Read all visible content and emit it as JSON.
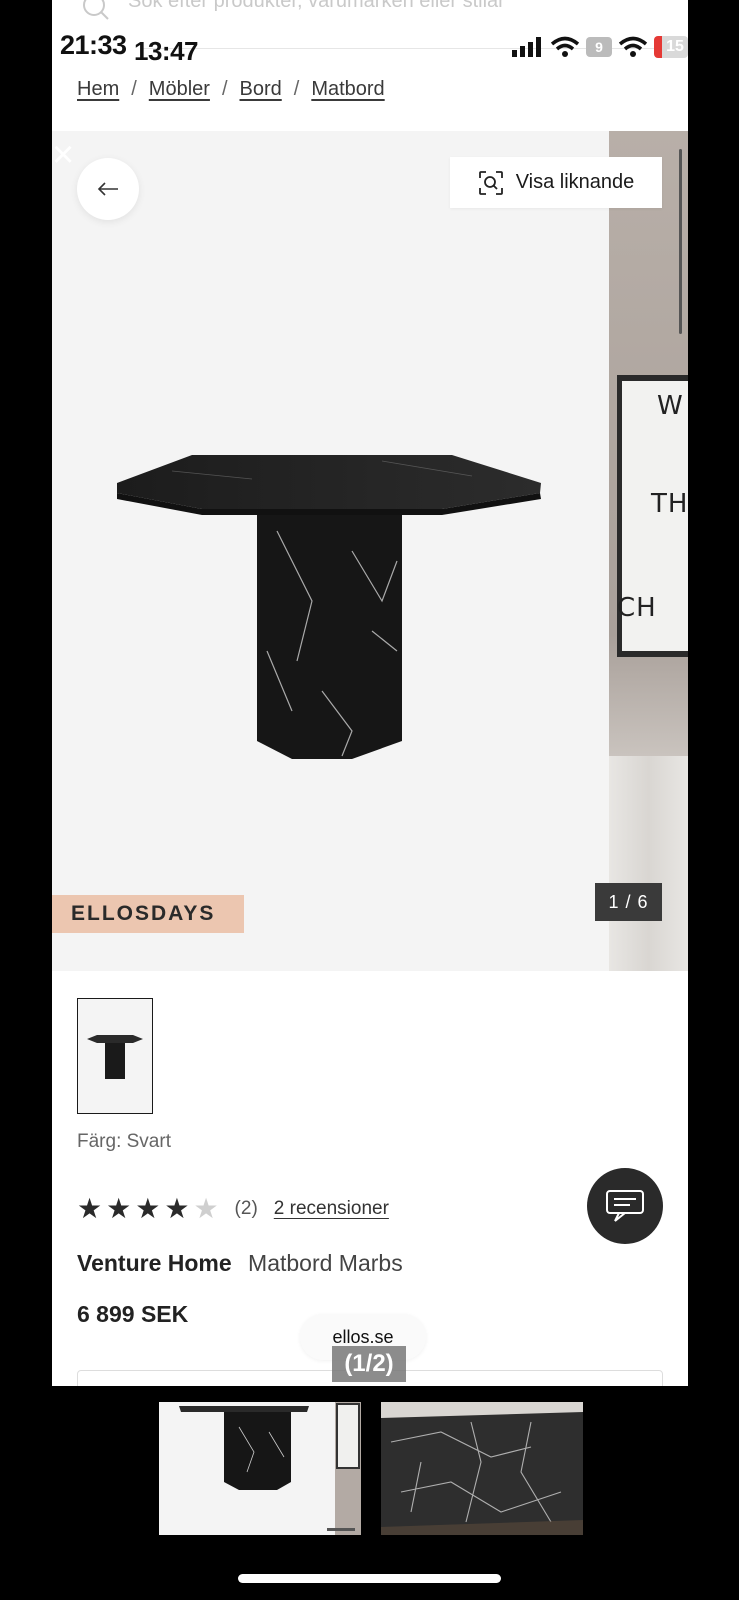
{
  "status_bar": {
    "time_primary": "21:33",
    "time_secondary": "13:47",
    "battery_primary": "9",
    "battery_secondary": "15"
  },
  "search": {
    "placeholder": "Sök efter produkter, varumärken eller stilar"
  },
  "breadcrumb": [
    {
      "label": "Hem"
    },
    {
      "label": "Möbler"
    },
    {
      "label": "Bord"
    },
    {
      "label": "Matbord"
    }
  ],
  "gallery": {
    "similar_label": "Visa liknande",
    "badge": "ELLOSDAYS",
    "counter": "1 / 6",
    "side_poster_lines": [
      "W",
      "THE",
      "CH"
    ]
  },
  "product": {
    "color_label": "Färg: Svart",
    "rating_value": 4,
    "rating_max": 5,
    "rating_count": "(2)",
    "reviews_link": "2 recensioner",
    "brand": "Venture Home",
    "name": "Matbord Marbs",
    "price": "6 899 SEK"
  },
  "overlay": {
    "site": "ellos.se",
    "page_indicator": "(1/2)"
  },
  "colors": {
    "badge_bg": "#ecc6b0",
    "counter_bg": "#3a3a3a",
    "chat_bg": "#2a2a2a"
  }
}
